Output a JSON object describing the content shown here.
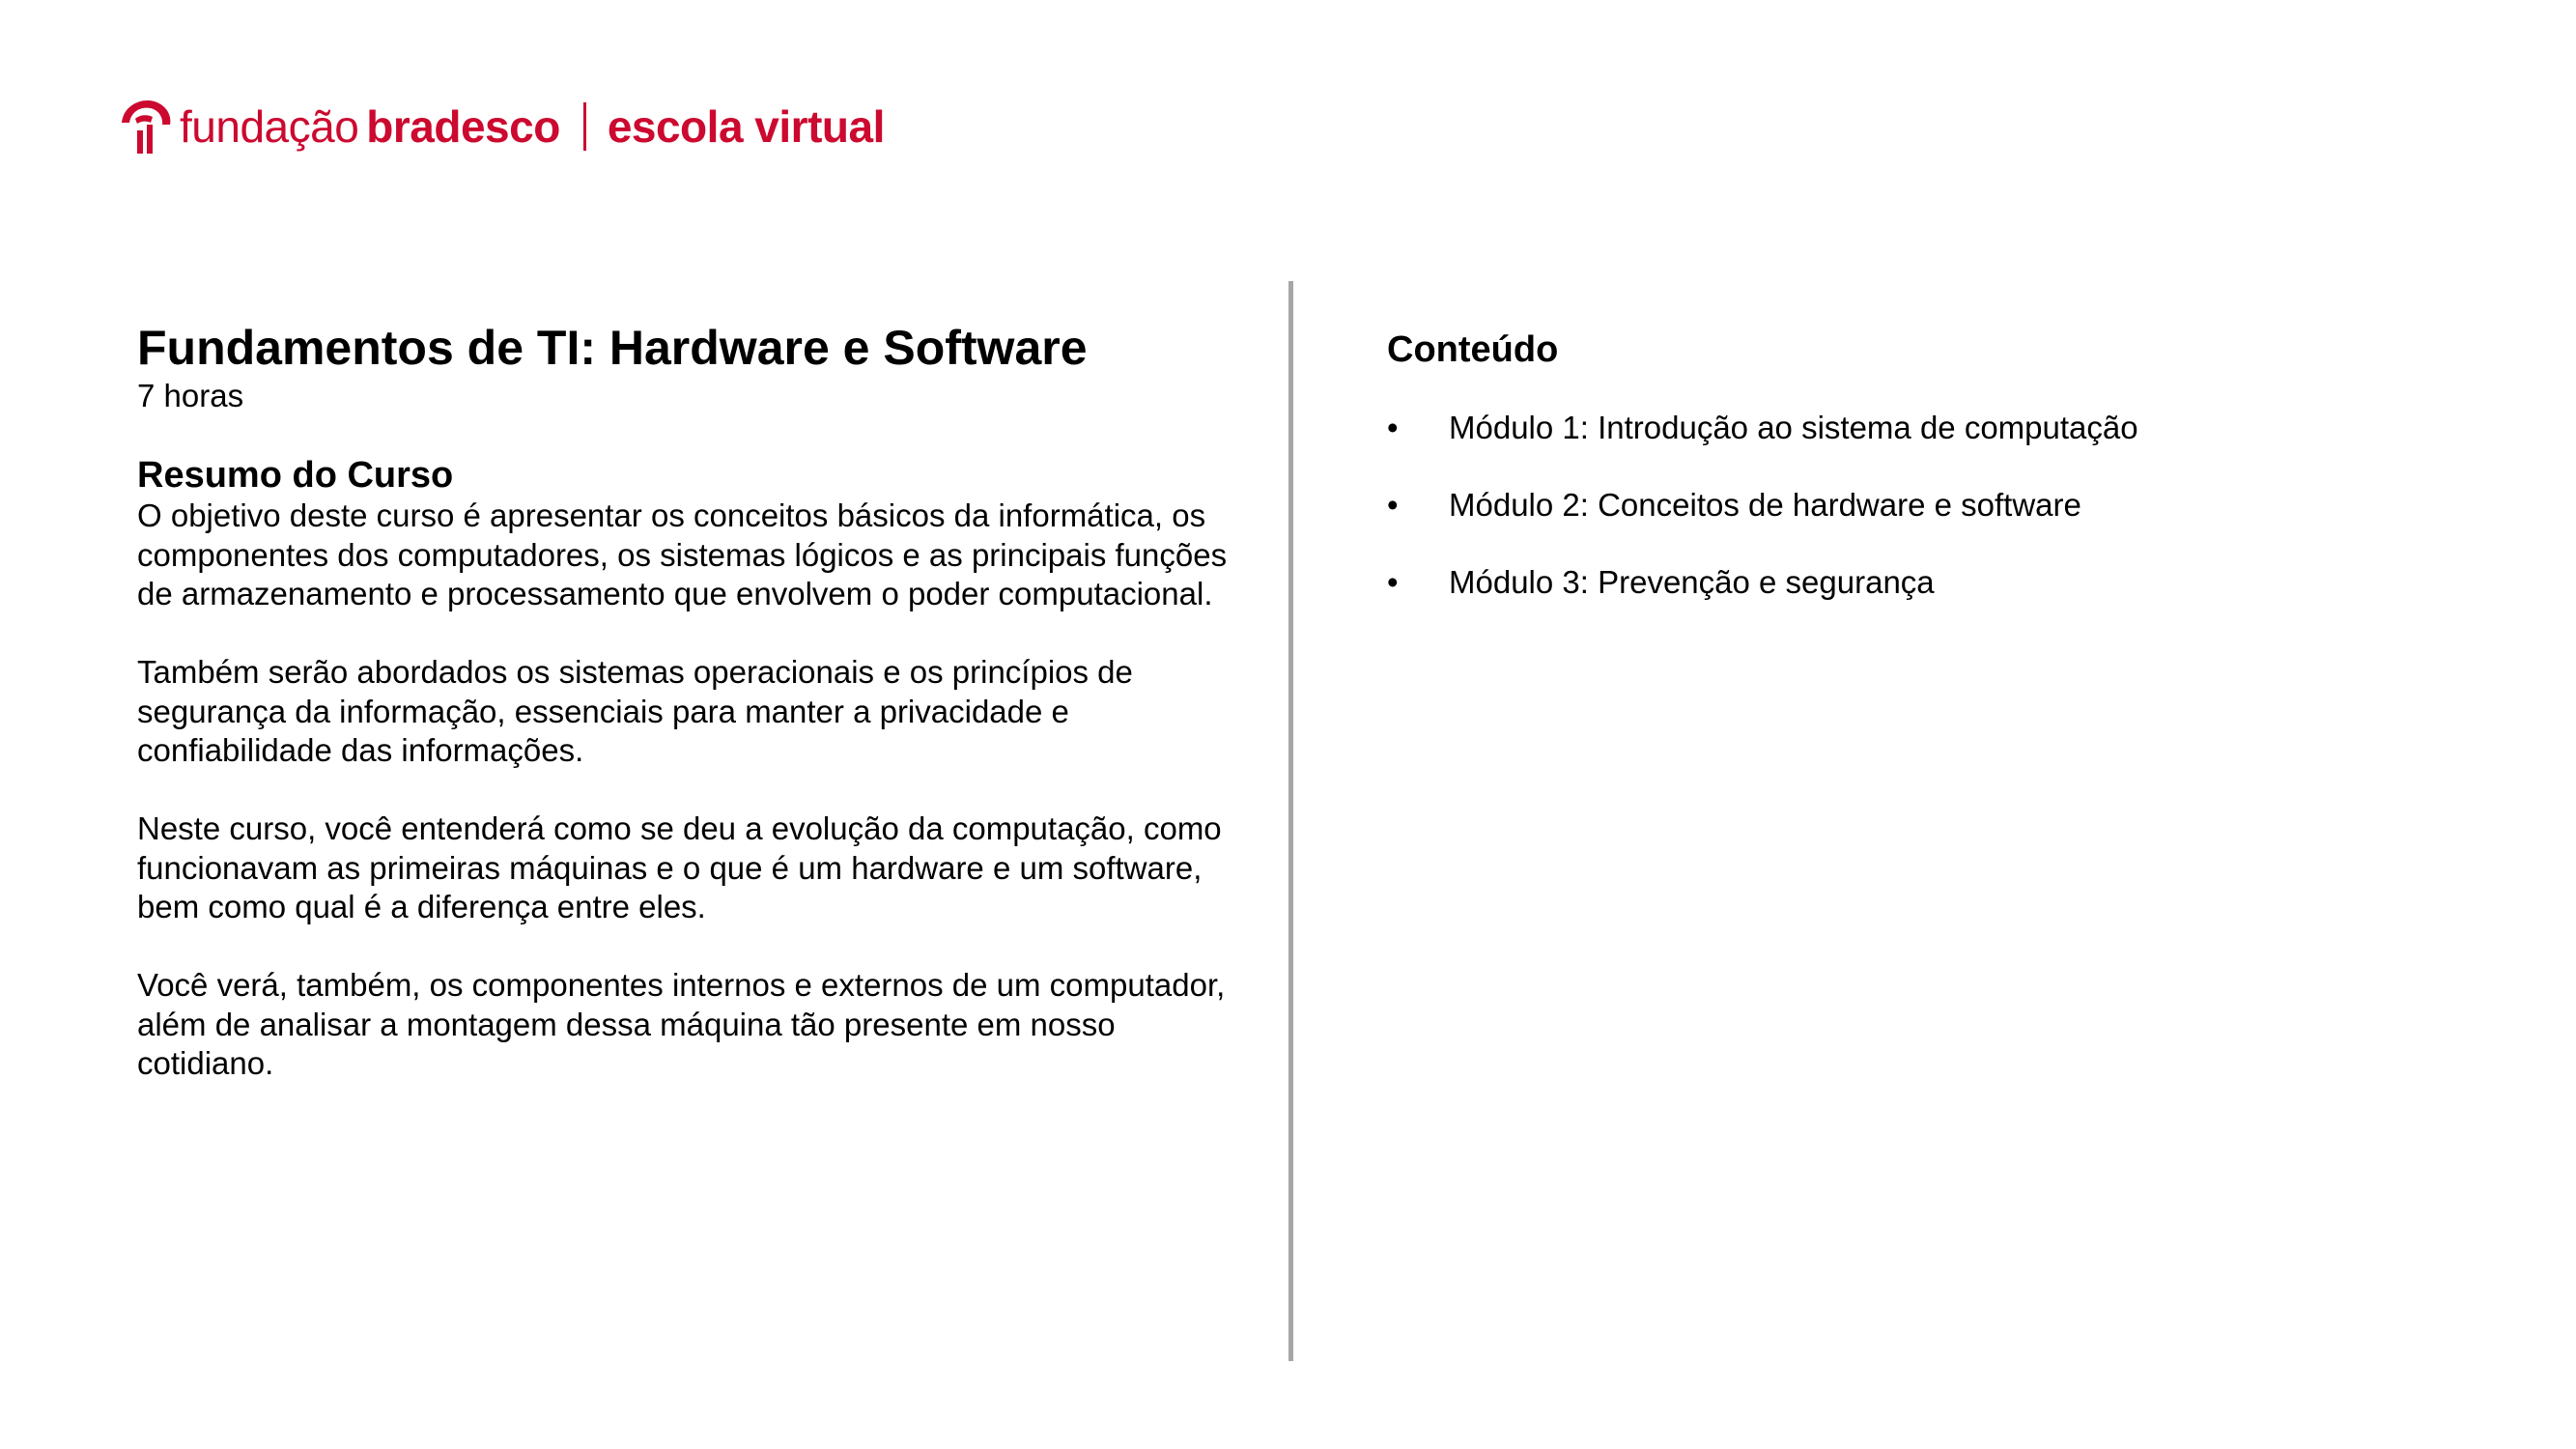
{
  "brand": {
    "name_light": "fundação",
    "name_bold": "bradesco",
    "separator": "|",
    "subtitle": "escola virtual",
    "color": "#cc092f"
  },
  "course": {
    "title": "Fundamentos de TI: Hardware e Software",
    "duration": "7 horas",
    "summary_heading": "Resumo do Curso",
    "summary_paragraphs": [
      "O objetivo deste curso é apresentar os conceitos básicos da informática, os componentes dos computadores, os sistemas lógicos e as principais funções de armazenamento e processamento que envolvem o poder computacional.",
      "Também serão abordados os sistemas operacionais e os princípios de segurança da informação, essenciais para manter a privacidade e confiabilidade das informações.",
      "Neste curso, você entenderá como se deu a evolução da computação, como funcionavam as primeiras máquinas e o que é um hardware e um software, bem como qual é a diferença entre eles.",
      "Você verá, também, os componentes internos e externos de um computador, além de analisar a montagem dessa máquina tão presente em nosso cotidiano."
    ]
  },
  "content": {
    "heading": "Conteúdo",
    "bullet": "•",
    "modules": [
      "Módulo 1: Introdução ao sistema de computação",
      "Módulo 2: Conceitos de hardware e software",
      "Módulo 3: Prevenção e segurança"
    ]
  },
  "colors": {
    "divider": "#a6a6a6",
    "text": "#000000"
  }
}
